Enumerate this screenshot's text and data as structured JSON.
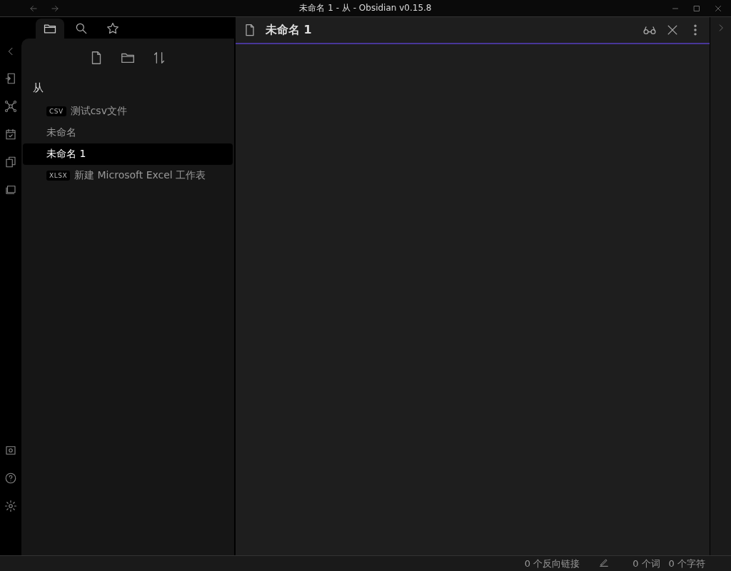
{
  "window": {
    "title": "未命名 1 - 从 - Obsidian v0.15.8"
  },
  "sidebar_tabs": [
    {
      "kind": "folder",
      "selected": true
    },
    {
      "kind": "search",
      "selected": false
    },
    {
      "kind": "star",
      "selected": false
    }
  ],
  "folder": {
    "name": "从",
    "files": [
      {
        "name": "测试csv文件",
        "badge": "CSV",
        "selected": false
      },
      {
        "name": "未命名",
        "selected": false
      },
      {
        "name": "未命名 1",
        "selected": true
      },
      {
        "name": "新建 Microsoft Excel 工作表",
        "badge": "XLSX",
        "selected": false
      }
    ]
  },
  "editor": {
    "tab_title": "未命名 1"
  },
  "status_bar": {
    "backlinks": "0 个反向链接",
    "words": "0 个词",
    "characters": "0 个字符"
  }
}
